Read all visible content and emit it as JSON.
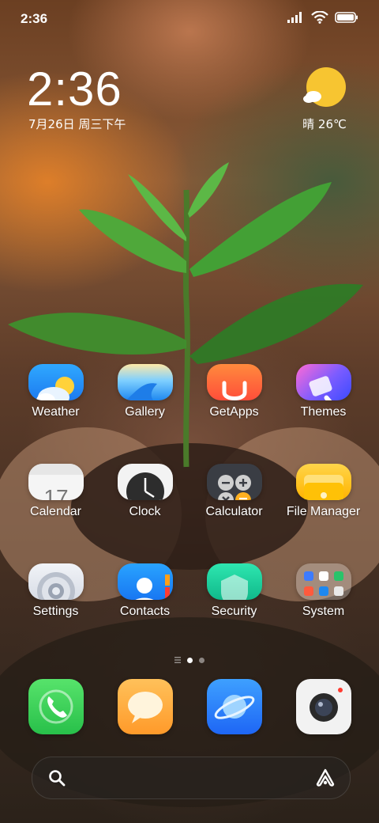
{
  "status": {
    "time": "2:36"
  },
  "lockclock": {
    "time": "2:36",
    "date": "7月26日 周三下午"
  },
  "weather": {
    "condition": "晴",
    "temp": "26℃"
  },
  "apps": {
    "weather": "Weather",
    "gallery": "Gallery",
    "getapps": "GetApps",
    "themes": "Themes",
    "calendar": "Calendar",
    "calendar_day": "17",
    "clock": "Clock",
    "calculator": "Calculator",
    "filemanager": "File Manager",
    "settings": "Settings",
    "contacts": "Contacts",
    "security": "Security",
    "system": "System"
  },
  "dock": [
    "phone-icon",
    "messages-icon",
    "browser-icon",
    "camera-icon"
  ],
  "page_indicator": {
    "pages": 2,
    "current": 1
  },
  "colors": {
    "accent_green": "#3fd158",
    "sun": "#f7c531"
  }
}
